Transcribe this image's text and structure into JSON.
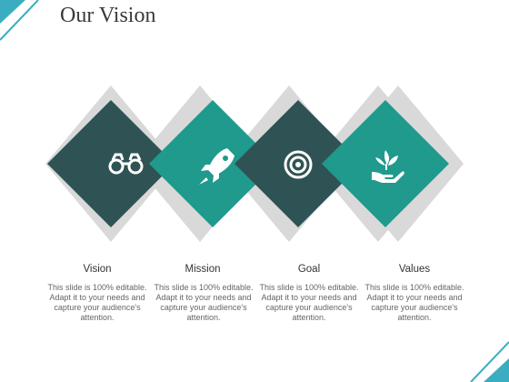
{
  "slide": {
    "title": "Our Vision"
  },
  "items": [
    {
      "label": "Vision",
      "icon": "binoculars-icon",
      "description": "This slide is 100% editable. Adapt it to your needs and capture your audience's attention."
    },
    {
      "label": "Mission",
      "icon": "rocket-icon",
      "description": "This slide is 100% editable. Adapt it to your needs and capture your audience's attention."
    },
    {
      "label": "Goal",
      "icon": "target-icon",
      "description": "This slide is 100% editable. Adapt it to your needs and capture your audience's attention."
    },
    {
      "label": "Values",
      "icon": "plant-hand-icon",
      "description": "This slide is 100% editable. Adapt it to your needs and capture your audience's attention."
    }
  ],
  "colors": {
    "dark": "#2f5354",
    "teal": "#1f9a8c",
    "border": "#d9d9d9",
    "accent": "#3aaec0"
  }
}
